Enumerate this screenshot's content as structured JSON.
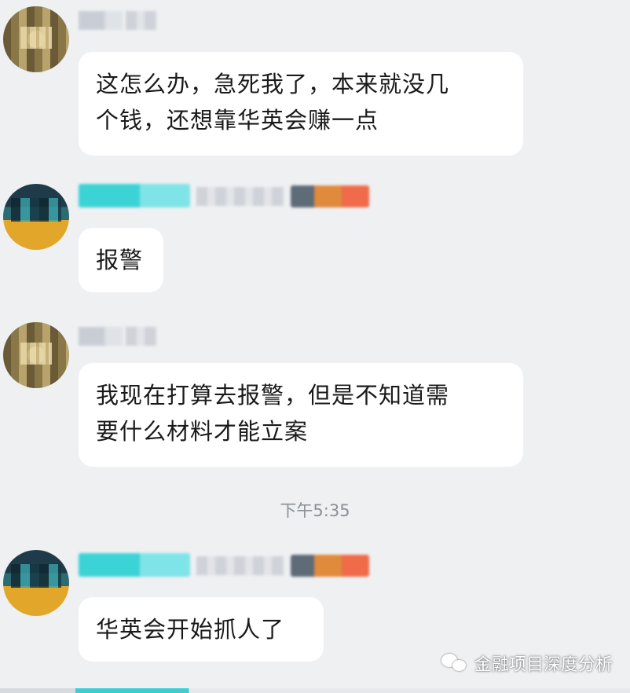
{
  "messages": [
    {
      "avatar": "brown-pixelated-avatar",
      "text_line1": "这怎么办，急死我了，本来就没几",
      "text_line2": "个钱，还想靠华英会赚一点"
    },
    {
      "avatar": "teal-pixelated-avatar",
      "text_line1": "报警"
    },
    {
      "avatar": "brown-pixelated-avatar",
      "text_line1": "我现在打算去报警，但是不知道需",
      "text_line2": "要什么材料才能立案"
    },
    {
      "avatar": "teal-pixelated-avatar",
      "text_line1": "华英会开始抓人了"
    }
  ],
  "timestamp": "下午5:35",
  "watermark": {
    "icon": "wechat-icon",
    "text": "金融项目深度分析"
  },
  "colors": {
    "background": "#eef0f2",
    "bubble": "#ffffff",
    "teal_name": "#3cd3d6"
  }
}
